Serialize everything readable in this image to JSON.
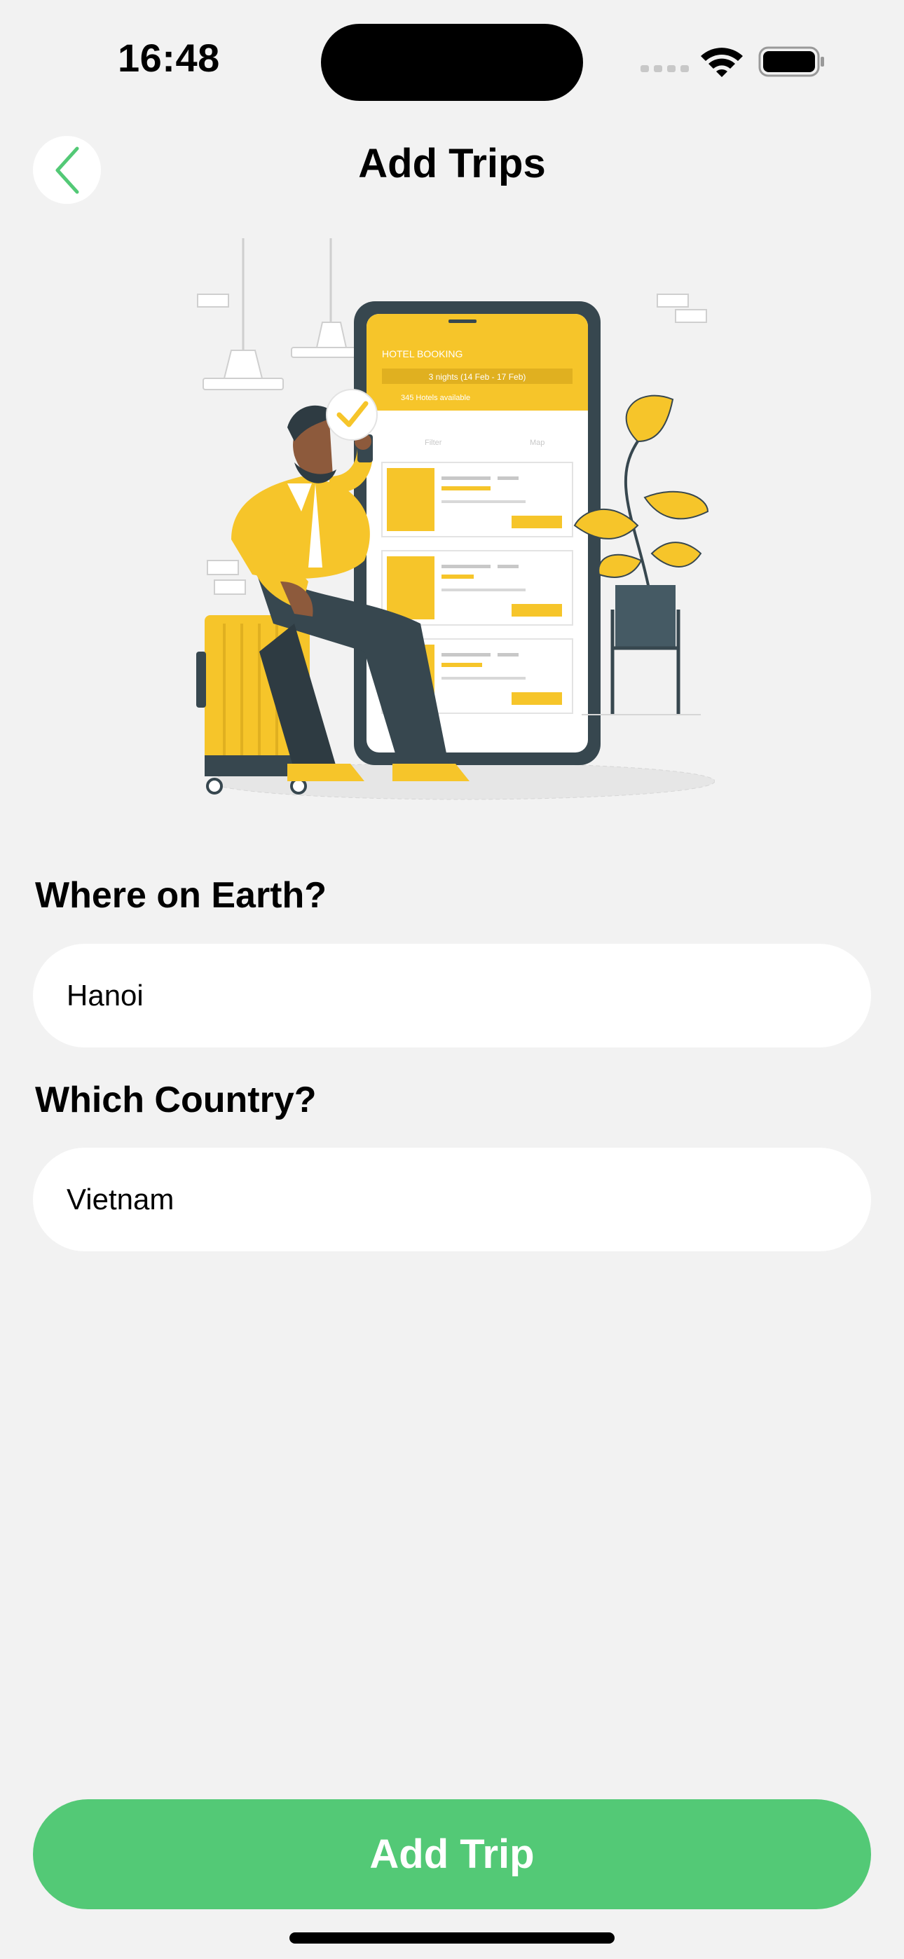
{
  "status_bar": {
    "time": "16:48",
    "icons": [
      "signal-icon",
      "wifi-icon",
      "battery-icon"
    ]
  },
  "header": {
    "title": "Add Trips",
    "back_icon": "chevron-left-icon"
  },
  "illustration": {
    "phone_header": "HOTEL BOOKING",
    "phone_dates": "3 nights (14 Feb - 17 Feb)",
    "phone_results": "345 Hotels available",
    "phone_filter": "Filter",
    "phone_map": "Map"
  },
  "form": {
    "destination_label": "Where on Earth?",
    "destination_value": "Hanoi",
    "country_label": "Which Country?",
    "country_value": "Vietnam"
  },
  "actions": {
    "add_trip_label": "Add Trip"
  },
  "colors": {
    "accent": "#53c976",
    "background": "#f2f2f2",
    "illustration_yellow": "#f6c52a"
  }
}
